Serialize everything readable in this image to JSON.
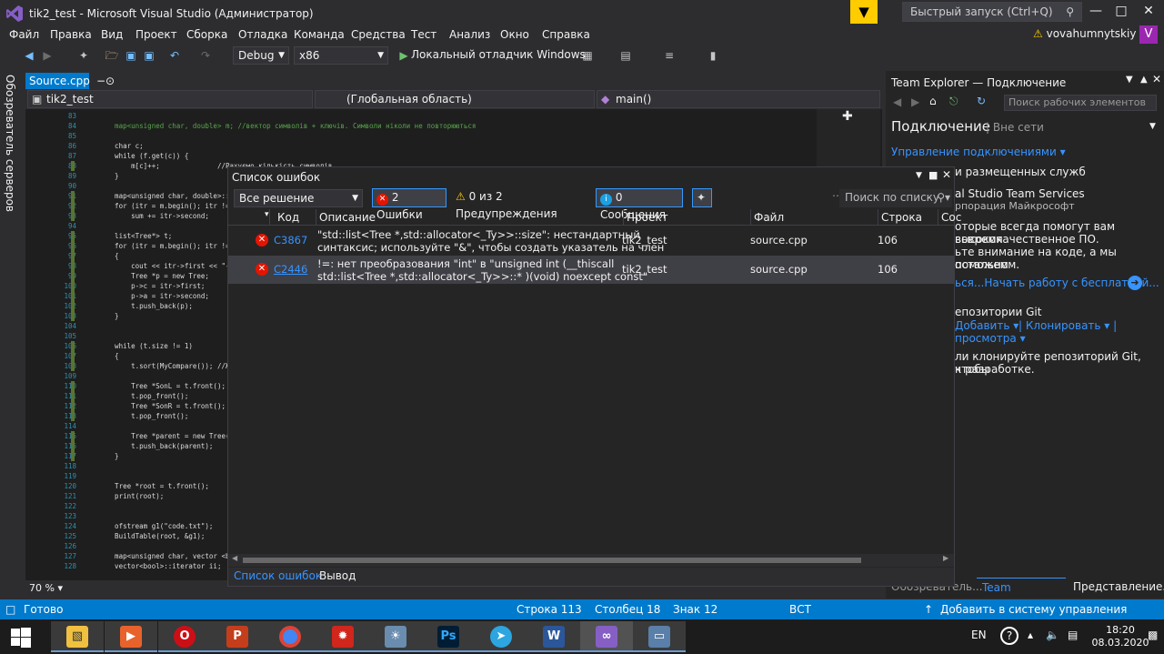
{
  "window": {
    "title": "tik2_test - Microsoft Visual Studio  (Администратор)",
    "quick_launch_placeholder": "Быстрый запуск (Ctrl+Q)",
    "user": "vovahumnytskiy",
    "avatar_letter": "V"
  },
  "menu": [
    "Файл",
    "Правка",
    "Вид",
    "Проект",
    "Сборка",
    "Отладка",
    "Команда",
    "Средства",
    "Тест",
    "Анализ",
    "Окно",
    "Справка"
  ],
  "toolbar": {
    "config": "Debug",
    "platform": "x86",
    "run_label": "Локальный отладчик Windows"
  },
  "left_strip_label": "Обозреватель серверов",
  "editor": {
    "tab": "Source.cpp",
    "nav_project": "tik2_test",
    "nav_scope": "(Глобальная область)",
    "nav_member": "main()",
    "zoom": "70 %",
    "lines": [
      {
        "n": "83",
        "t": ""
      },
      {
        "n": "84",
        "t": "    map<unsigned char, double> m; //вектор символів + ключів. Символи ніколи не повторюються"
      },
      {
        "n": "85",
        "t": ""
      },
      {
        "n": "86",
        "t": "    char c;"
      },
      {
        "n": "87",
        "t": "    while (f.get(c)) {"
      },
      {
        "n": "88",
        "t": "        m[c]++;              //Рахуємо кількість символів"
      },
      {
        "n": "89",
        "t": "    }"
      },
      {
        "n": "90",
        "t": ""
      },
      {
        "n": "91",
        "t": "    map<unsigned char, double>::it"
      },
      {
        "n": "92",
        "t": "    for (itr = m.begin(); itr != m"
      },
      {
        "n": "93",
        "t": "        sum += itr->second;"
      },
      {
        "n": "94",
        "t": ""
      },
      {
        "n": "95",
        "t": "    list<Tree*> t;"
      },
      {
        "n": "96",
        "t": "    for (itr = m.begin(); itr != m"
      },
      {
        "n": "97",
        "t": "    {"
      },
      {
        "n": "98",
        "t": "        cout << itr->first << \"--\""
      },
      {
        "n": "99",
        "t": "        Tree *p = new Tree;"
      },
      {
        "n": "100",
        "t": "        p->c = itr->first;"
      },
      {
        "n": "101",
        "t": "        p->a = itr->second;"
      },
      {
        "n": "102",
        "t": "        t.push_back(p);"
      },
      {
        "n": "103",
        "t": "    }"
      },
      {
        "n": "104",
        "t": ""
      },
      {
        "n": "105",
        "t": ""
      },
      {
        "n": "106",
        "t": "    while (t.size != 1)"
      },
      {
        "n": "107",
        "t": "    {"
      },
      {
        "n": "108",
        "t": "        t.sort(MyCompare()); //ЖТР"
      },
      {
        "n": "109",
        "t": ""
      },
      {
        "n": "110",
        "t": "        Tree *SonL = t.front();"
      },
      {
        "n": "111",
        "t": "        t.pop_front();"
      },
      {
        "n": "112",
        "t": "        Tree *SonR = t.front();"
      },
      {
        "n": "113",
        "t": "        t.pop_front();"
      },
      {
        "n": "114",
        "t": ""
      },
      {
        "n": "115",
        "t": "        Tree *parent = new Tree(So"
      },
      {
        "n": "116",
        "t": "        t.push_back(parent);"
      },
      {
        "n": "117",
        "t": "    }"
      },
      {
        "n": "118",
        "t": ""
      },
      {
        "n": "119",
        "t": ""
      },
      {
        "n": "120",
        "t": "    Tree *root = t.front();"
      },
      {
        "n": "121",
        "t": "    print(root);"
      },
      {
        "n": "122",
        "t": ""
      },
      {
        "n": "123",
        "t": ""
      },
      {
        "n": "124",
        "t": "    ofstream g1(\"code.txt\");"
      },
      {
        "n": "125",
        "t": "    BuildTable(root, &g1);"
      },
      {
        "n": "126",
        "t": ""
      },
      {
        "n": "127",
        "t": "    map<unsigned char, vector <boo"
      },
      {
        "n": "128",
        "t": "    vector<bool>::iterator ii;"
      }
    ]
  },
  "error_list": {
    "title": "Список ошибок",
    "scope": "Все решение",
    "errors_btn": "2 Ошибки",
    "warnings_btn": "0 из 2 Предупреждения",
    "messages_btn": "0 Сообщения",
    "search_placeholder": "Поиск по списку",
    "columns": [
      "Код",
      "Описание",
      "Проект",
      "Файл",
      "Строка",
      "Сос"
    ],
    "rows": [
      {
        "code": "C3867",
        "desc1": "\"std::list<Tree *,std::allocator<_Ty>>::size\": нестандартный",
        "desc2": "синтаксис; используйте \"&\", чтобы создать указатель на член",
        "project": "tik2_test",
        "file": "source.cpp",
        "line": "106"
      },
      {
        "code": "C2446",
        "desc1": "!=: нет преобразования \"int\" в \"unsigned int (__thiscall",
        "desc2": "std::list<Tree *,std::allocator<_Ty>>::* )(void) noexcept const\"",
        "project": "tik2_test",
        "file": "source.cpp",
        "line": "106"
      }
    ],
    "bottom_tabs": [
      "Список ошибок",
      "Вывод"
    ]
  },
  "team_explorer": {
    "title": "Team Explorer — Подключение",
    "search_placeholder": "Поиск рабочих элементов",
    "heading": "Подключение",
    "heading_sub": "Вне сети",
    "manage": "Управление подключениями",
    "hosted_title": "и размещенных служб",
    "vsts_title": "al Studio Team Services",
    "vsts_sub": "рпорация Майкрософт",
    "promo1": "оторые всегда помогут вам вовремя",
    "promo2": "высококачественное ПО.",
    "promo3": "ьте внимание на коде, а мы поможем",
    "promo4": "остальном.",
    "promo_link": "ься...Начать работу с бесплатной...",
    "git_title": "епозитории Git",
    "git_add": "Добавить",
    "git_clone": "Клонировать",
    "git_view": "просмотра",
    "git_text1": "ли клонируйте репозиторий Git, чтобы",
    "git_text2": "к разработке.",
    "tabs": [
      "Обозреватель...",
      "Team Explorer...",
      "Представление..."
    ]
  },
  "status": {
    "ready": "Готово",
    "line": "Строка 113",
    "col": "Столбец 18",
    "char": "Знак 12",
    "mode": "ВСТ",
    "vcs": "Добавить в систему управления версиями"
  },
  "taskbar": {
    "lang": "EN",
    "time": "18:20",
    "date": "08.03.2020"
  },
  "colors": {
    "accent": "#007acc",
    "error": "#e51400",
    "link": "#3794ff"
  }
}
